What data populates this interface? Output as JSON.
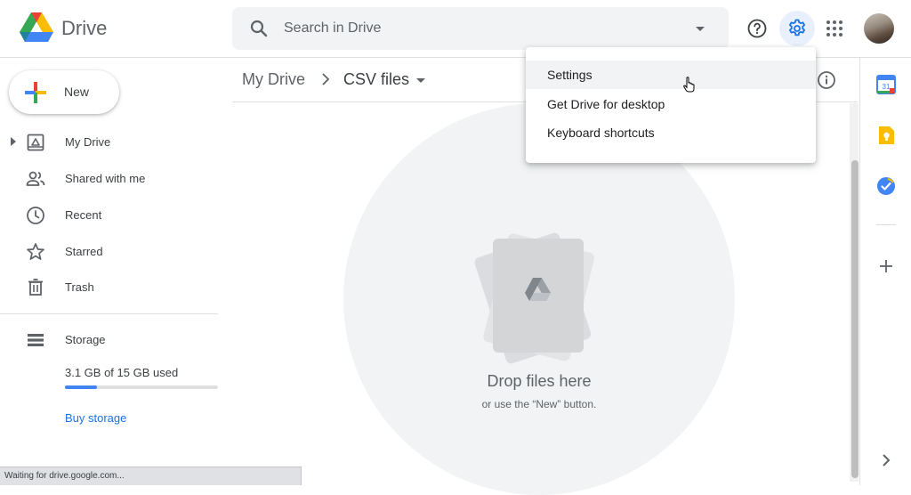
{
  "header": {
    "app_name": "Drive",
    "search": {
      "placeholder": "Search in Drive",
      "value": ""
    }
  },
  "sidebar": {
    "new_label": "New",
    "items": [
      {
        "label": "My Drive",
        "icon": "my-drive-icon"
      },
      {
        "label": "Shared with me",
        "icon": "people-icon"
      },
      {
        "label": "Recent",
        "icon": "clock-icon"
      },
      {
        "label": "Starred",
        "icon": "star-icon"
      },
      {
        "label": "Trash",
        "icon": "trash-icon"
      }
    ],
    "storage": {
      "label": "Storage",
      "usage_text": "3.1 GB of 15 GB used",
      "used_fraction": 0.207,
      "buy_label": "Buy storage"
    }
  },
  "main": {
    "breadcrumb": {
      "root": "My Drive",
      "current": "CSV files"
    },
    "empty_state": {
      "title": "Drop files here",
      "subtitle": "or use the “New” button."
    }
  },
  "settings_menu": {
    "items": [
      {
        "label": "Settings",
        "hovered": true
      },
      {
        "label": "Get Drive for desktop",
        "hovered": false
      },
      {
        "label": "Keyboard shortcuts",
        "hovered": false
      }
    ]
  },
  "side_panel": {
    "apps": [
      "calendar-icon",
      "keep-icon",
      "tasks-icon"
    ],
    "calendar_day": "31"
  },
  "status_bar": {
    "text": "Waiting for drive.google.com..."
  },
  "colors": {
    "accent": "#1a73e8",
    "google_blue": "#4285f4",
    "google_red": "#ea4335",
    "google_yellow": "#fbbc04",
    "google_green": "#34a853"
  }
}
